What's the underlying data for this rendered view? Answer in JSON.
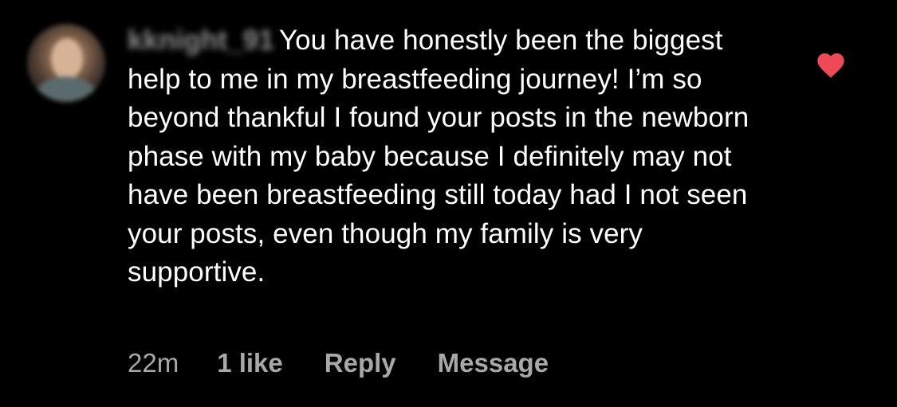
{
  "comment": {
    "username": "kknight_91",
    "text": "You have honestly been the biggest help to me in my breastfeeding journey! I’m so beyond thankful I found your posts in the newborn phase with my baby because I definitely may not have been breastfeeding still today had I not seen your posts, even though my family is very supportive.",
    "time": "22m",
    "likes_label": "1 like",
    "reply_label": "Reply",
    "message_label": "Message",
    "liked": true
  },
  "icons": {
    "avatar": "user-avatar",
    "like": "heart-icon"
  },
  "colors": {
    "background": "#000000",
    "text": "#ffffff",
    "meta": "#a8a8a8",
    "heart": "#ed4956"
  }
}
